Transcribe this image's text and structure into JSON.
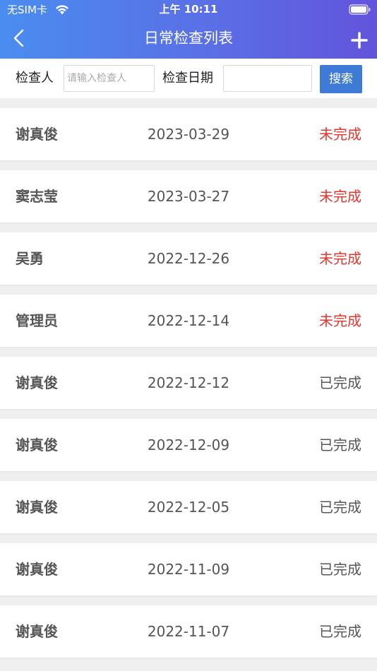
{
  "status_bar": {
    "carrier": "无SIM卡",
    "time": "上午 10:11",
    "wifi_icon": "wifi-icon",
    "battery_icon": "battery-icon"
  },
  "nav": {
    "title": "日常检查列表",
    "back_icon": "chevron-left-icon",
    "add_icon": "plus-icon"
  },
  "search": {
    "inspector_label": "检查人",
    "inspector_placeholder": "请输入检查人",
    "inspector_value": "",
    "date_label": "检查日期",
    "date_value": "",
    "button_label": "搜索"
  },
  "colors": {
    "header_gradient_start": "#4a8df0",
    "header_gradient_end": "#6254dc",
    "search_button": "#3d7bd6",
    "status_incomplete": "#e8342c",
    "status_complete": "#555555"
  },
  "records": [
    {
      "name": "谢真俊",
      "date": "2023-03-29",
      "status": "未完成",
      "complete": false
    },
    {
      "name": "窦志莹",
      "date": "2023-03-27",
      "status": "未完成",
      "complete": false
    },
    {
      "name": "吴勇",
      "date": "2022-12-26",
      "status": "未完成",
      "complete": false
    },
    {
      "name": "管理员",
      "date": "2022-12-14",
      "status": "未完成",
      "complete": false
    },
    {
      "name": "谢真俊",
      "date": "2022-12-12",
      "status": "已完成",
      "complete": true
    },
    {
      "name": "谢真俊",
      "date": "2022-12-09",
      "status": "已完成",
      "complete": true
    },
    {
      "name": "谢真俊",
      "date": "2022-12-05",
      "status": "已完成",
      "complete": true
    },
    {
      "name": "谢真俊",
      "date": "2022-11-09",
      "status": "已完成",
      "complete": true
    },
    {
      "name": "谢真俊",
      "date": "2022-11-07",
      "status": "已完成",
      "complete": true
    }
  ]
}
